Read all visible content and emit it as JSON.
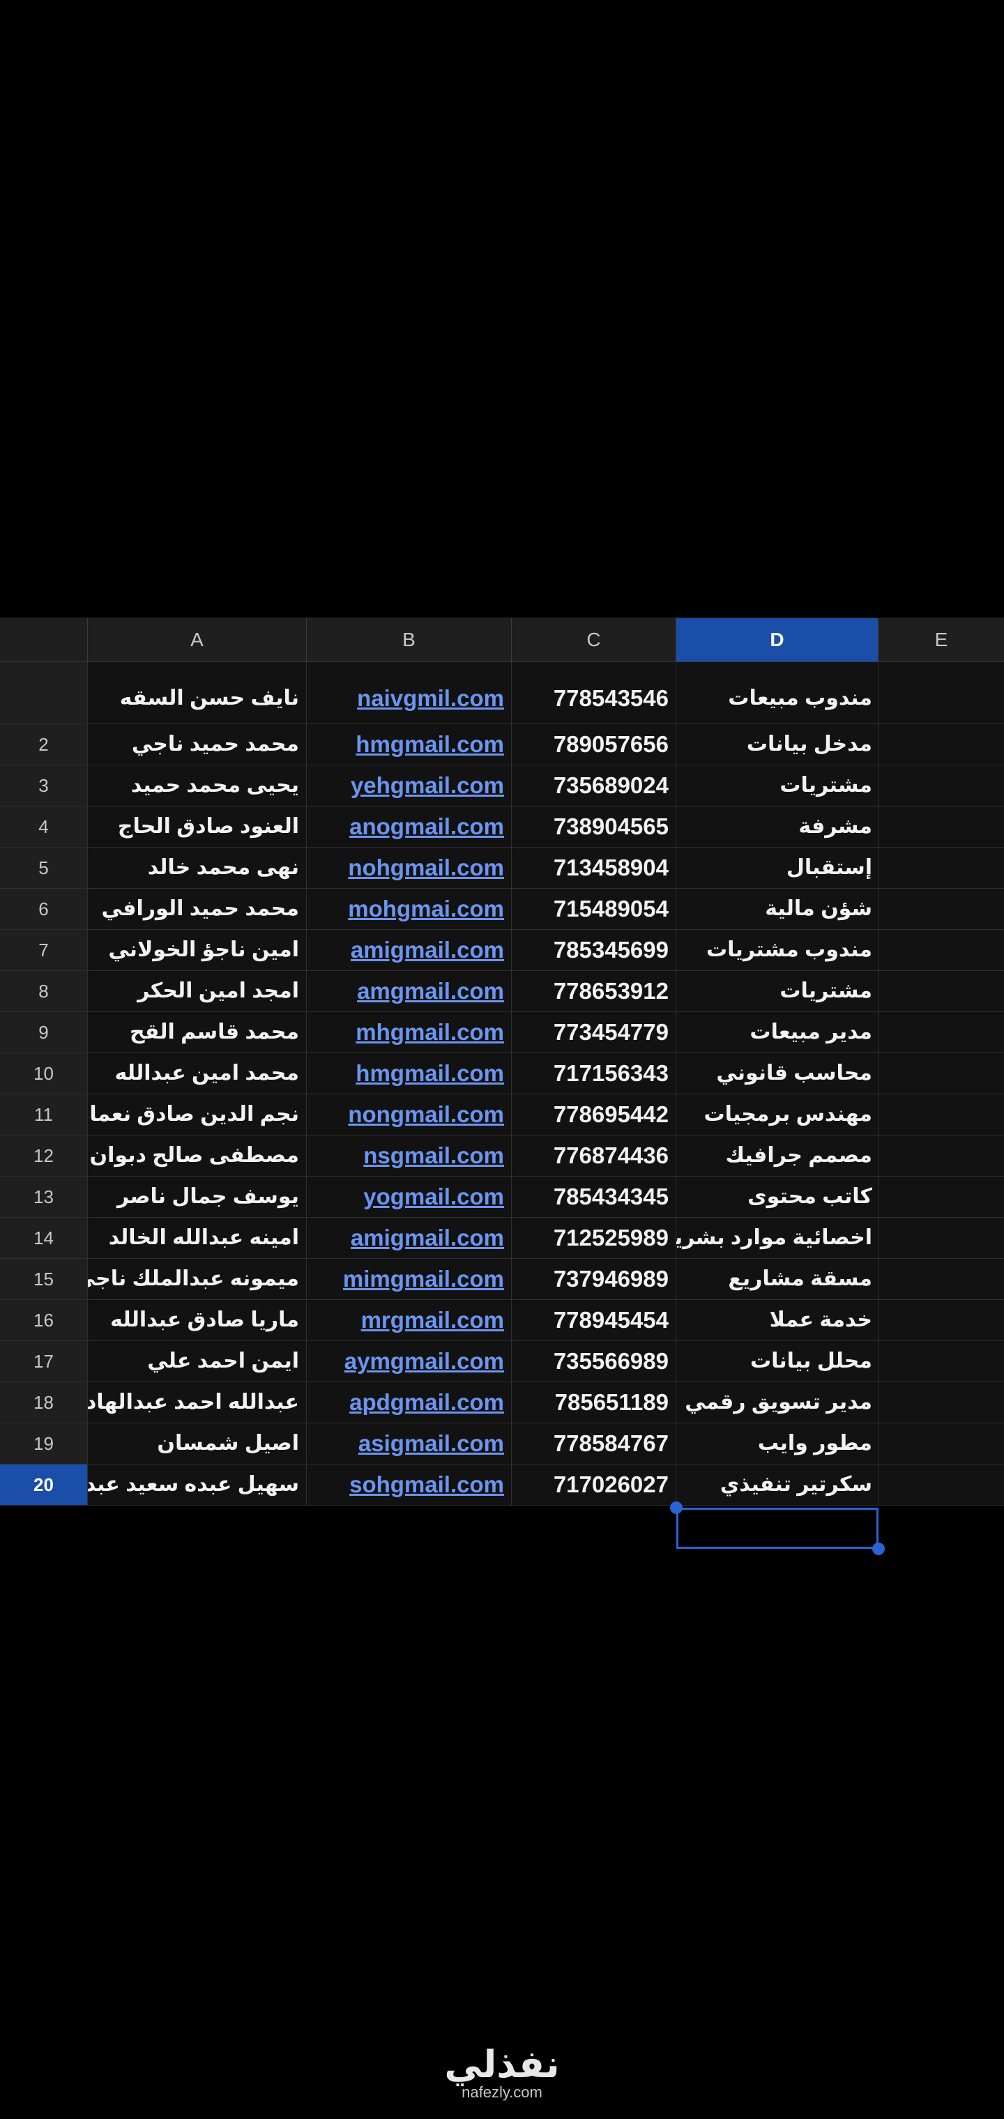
{
  "columns": [
    "A",
    "B",
    "C",
    "D",
    "E"
  ],
  "active_column": "D",
  "rows": [
    {
      "num": "",
      "name": "نايف حسن السقه",
      "email": "naivgmil.com",
      "phone": "778543546",
      "job": "مندوب مبيعات"
    },
    {
      "num": "2",
      "name": "محمد حميد ناجي",
      "email": "hmgmail.com",
      "phone": "789057656",
      "job": "مدخل بيانات"
    },
    {
      "num": "3",
      "name": "يحيى محمد حميد",
      "email": "yehgmail.com",
      "phone": "735689024",
      "job": "مشتريات"
    },
    {
      "num": "4",
      "name": "العنود صادق الحاج",
      "email": "anogmail.com",
      "phone": "738904565",
      "job": "مشرفة"
    },
    {
      "num": "5",
      "name": "نهى محمد خالد",
      "email": "nohgmail.com",
      "phone": "713458904",
      "job": "إستقبال"
    },
    {
      "num": "6",
      "name": "محمد حميد الورافي",
      "email": "mohgmai.com",
      "phone": "715489054",
      "job": "شؤن مالية"
    },
    {
      "num": "7",
      "name": "امين ناجؤ الخولاني",
      "email": "amigmail.com",
      "phone": "785345699",
      "job": "مندوب مشتريات"
    },
    {
      "num": "8",
      "name": "امجد امين الحكر",
      "email": "amgmail.com",
      "phone": "778653912",
      "job": "مشتريات"
    },
    {
      "num": "9",
      "name": "محمد قاسم القح",
      "email": "mhgmail.com",
      "phone": "773454779",
      "job": "مدير مبيعات"
    },
    {
      "num": "10",
      "name": "محمد امين عبدالله",
      "email": "hmgmail.com",
      "phone": "717156343",
      "job": "محاسب قانوني"
    },
    {
      "num": "11",
      "name": "نجم الدين صادق نعمان",
      "email": "nongmail.com",
      "phone": "778695442",
      "job": "مهندس برمجيات"
    },
    {
      "num": "12",
      "name": "مصطفى صالح دبوان",
      "email": "nsgmail.com",
      "phone": "776874436",
      "job": "مصمم جرافيك"
    },
    {
      "num": "13",
      "name": "يوسف جمال ناصر",
      "email": "yogmail.com",
      "phone": "785434345",
      "job": "كاتب محتوى"
    },
    {
      "num": "14",
      "name": "امينه عبدالله الخالد",
      "email": "amigmail.com",
      "phone": "712525989",
      "job": "اخصائية موارد بشريه"
    },
    {
      "num": "15",
      "name": "ميمونه عبدالملك ناجي",
      "email": "mimgmail.com",
      "phone": "737946989",
      "job": "مسقة مشاريع"
    },
    {
      "num": "16",
      "name": "ماريا صادق عبدالله",
      "email": "mrgmail.com",
      "phone": "778945454",
      "job": "خدمة عملا"
    },
    {
      "num": "17",
      "name": "ايمن احمد علي",
      "email": "aymgmail.com",
      "phone": "735566989",
      "job": "محلل بيانات"
    },
    {
      "num": "18",
      "name": "عبدالله احمد عبدالهادي",
      "email": "apdgmail.com",
      "phone": "785651189",
      "job": "مدير تسويق رقمي"
    },
    {
      "num": "19",
      "name": "اصيل شمسان",
      "email": "asigmail.com",
      "phone": "778584767",
      "job": "مطور وايب"
    },
    {
      "num": "20",
      "name": "سهيل عبده سعيد عبده",
      "email": "sohgmail.com",
      "phone": "717026027",
      "job": "سكرتير تنفيذي"
    }
  ],
  "selected_row": "20",
  "logo": {
    "arabic": "نفذلي",
    "latin": "nafezly.com"
  }
}
